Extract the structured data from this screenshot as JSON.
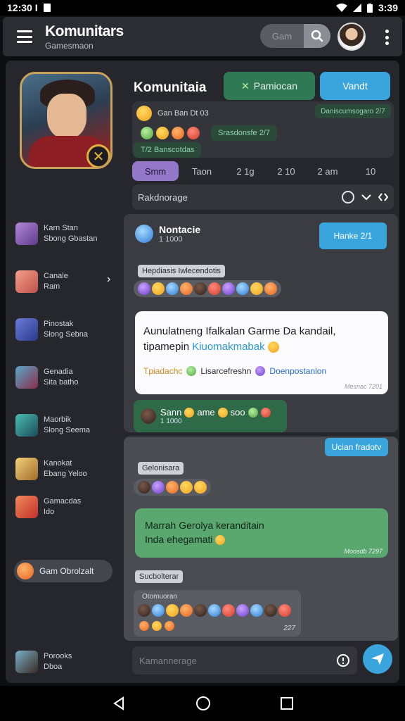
{
  "status_bar": {
    "time_left": "12:30 I",
    "time_right": "3:39"
  },
  "app_bar": {
    "title": "Komunitars",
    "subtitle": "Gamesmaon",
    "search_placeholder": "Gam"
  },
  "community": {
    "title": "Komunitaia",
    "primary_button": "Pamiocan",
    "secondary_button": "Vandt",
    "member_line": "Gan Ban Dt 03",
    "stamp": "Daniscumsogaro 2/7",
    "green_pill": "Srasdonsfe 2/7",
    "footer_note": "T/2 Banscotdas"
  },
  "tabs": [
    "Smm",
    "Taon",
    "2 1g",
    "2 10",
    "2 am",
    "10"
  ],
  "filter": {
    "label": "Rakdnorage"
  },
  "sidebar": {
    "items": [
      {
        "line1": "Karn Stan",
        "line2": "Sbong Gbastan"
      },
      {
        "line1": "Canale",
        "line2": "Ram"
      },
      {
        "line1": "Pinostak",
        "line2": "Slong Sebna"
      },
      {
        "line1": "Genadia",
        "line2": "Sita batho"
      },
      {
        "line1": "Maorbik",
        "line2": "Slong Seema"
      },
      {
        "line1": "Kanokat",
        "line2": "Ebang Yeloo"
      },
      {
        "line1": "Gamacdas",
        "line2": "Ido"
      }
    ],
    "pill": "Gam Obrolzalt",
    "footer": {
      "line1": "Porooks",
      "line2": "Dboa"
    }
  },
  "chat": {
    "header_name": "Nontacie",
    "header_meta": "1 1000",
    "top_right_bubble": "Hanke 2/1",
    "chip1": "Hepdiasis Iwlecendotis",
    "white_bubble": {
      "line1": "Aunulatneng Ifalkalan Garme Da kandail,",
      "line2_a": "tipamepin",
      "line2_b": "Kiuomakmabak",
      "link1": "Tpiadachc",
      "link2": "Lisarcefreshn",
      "link3": "Doenpostanlon",
      "timestamp": "Mesnac 7201"
    },
    "green_line": {
      "name": "Sann",
      "text": "ame",
      "text2": "soo",
      "meta": "1 1000"
    },
    "right_bubble2": "Ucian fradotv",
    "chip2": "Gelonisara",
    "green_bubble": {
      "line1": "Marrah Gerolya keranditain",
      "line2": "Inda ehegamati",
      "timestamp": "Moosdb 7297"
    },
    "chip3": "Sucbolterar",
    "emoji_card_label": "Otomuoran",
    "emoji_card_time": "227"
  },
  "composer": {
    "placeholder": "Kamannerage"
  }
}
